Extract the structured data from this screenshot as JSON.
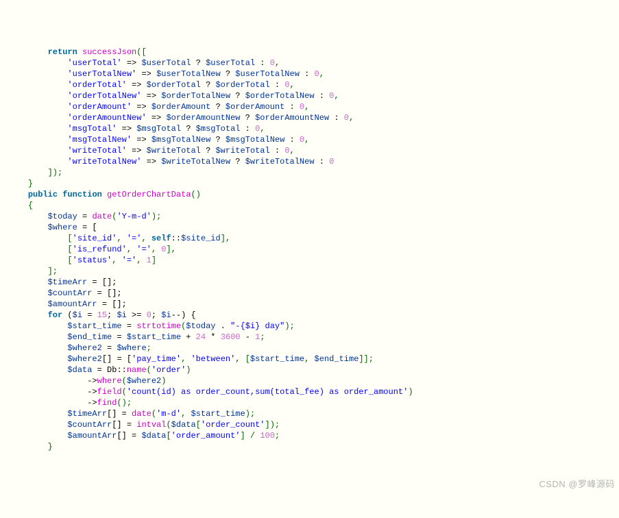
{
  "watermark": "CSDN @罗峰源码",
  "code": {
    "lines": [
      {
        "indent": 2,
        "tokens": [
          {
            "t": "kw",
            "v": "return"
          },
          {
            "t": "plain",
            "v": " "
          },
          {
            "t": "fn",
            "v": "successJson"
          },
          {
            "t": "punc",
            "v": "(["
          }
        ]
      },
      {
        "indent": 3,
        "tokens": [
          {
            "t": "str",
            "v": "'userTotal'"
          },
          {
            "t": "plain",
            "v": " => "
          },
          {
            "t": "var",
            "v": "$userTotal"
          },
          {
            "t": "plain",
            "v": " ? "
          },
          {
            "t": "var",
            "v": "$userTotal"
          },
          {
            "t": "plain",
            "v": " : "
          },
          {
            "t": "num",
            "v": "0"
          },
          {
            "t": "punc",
            "v": ","
          }
        ]
      },
      {
        "indent": 3,
        "tokens": [
          {
            "t": "str",
            "v": "'userTotalNew'"
          },
          {
            "t": "plain",
            "v": " => "
          },
          {
            "t": "var",
            "v": "$userTotalNew"
          },
          {
            "t": "plain",
            "v": " ? "
          },
          {
            "t": "var",
            "v": "$userTotalNew"
          },
          {
            "t": "plain",
            "v": " : "
          },
          {
            "t": "num",
            "v": "0"
          },
          {
            "t": "punc",
            "v": ","
          }
        ]
      },
      {
        "indent": 3,
        "tokens": [
          {
            "t": "str",
            "v": "'orderTotal'"
          },
          {
            "t": "plain",
            "v": " => "
          },
          {
            "t": "var",
            "v": "$orderTotal"
          },
          {
            "t": "plain",
            "v": " ? "
          },
          {
            "t": "var",
            "v": "$orderTotal"
          },
          {
            "t": "plain",
            "v": " : "
          },
          {
            "t": "num",
            "v": "0"
          },
          {
            "t": "punc",
            "v": ","
          }
        ]
      },
      {
        "indent": 3,
        "tokens": [
          {
            "t": "str",
            "v": "'orderTotalNew'"
          },
          {
            "t": "plain",
            "v": " => "
          },
          {
            "t": "var",
            "v": "$orderTotalNew"
          },
          {
            "t": "plain",
            "v": " ? "
          },
          {
            "t": "var",
            "v": "$orderTotalNew"
          },
          {
            "t": "plain",
            "v": " : "
          },
          {
            "t": "num",
            "v": "0"
          },
          {
            "t": "punc",
            "v": ","
          }
        ]
      },
      {
        "indent": 3,
        "tokens": [
          {
            "t": "str",
            "v": "'orderAmount'"
          },
          {
            "t": "plain",
            "v": " => "
          },
          {
            "t": "var",
            "v": "$orderAmount"
          },
          {
            "t": "plain",
            "v": " ? "
          },
          {
            "t": "var",
            "v": "$orderAmount"
          },
          {
            "t": "plain",
            "v": " : "
          },
          {
            "t": "num",
            "v": "0"
          },
          {
            "t": "punc",
            "v": ","
          }
        ]
      },
      {
        "indent": 3,
        "tokens": [
          {
            "t": "str",
            "v": "'orderAmountNew'"
          },
          {
            "t": "plain",
            "v": " => "
          },
          {
            "t": "var",
            "v": "$orderAmountNew"
          },
          {
            "t": "plain",
            "v": " ? "
          },
          {
            "t": "var",
            "v": "$orderAmountNew"
          },
          {
            "t": "plain",
            "v": " : "
          },
          {
            "t": "num",
            "v": "0"
          },
          {
            "t": "punc",
            "v": ","
          }
        ]
      },
      {
        "indent": 3,
        "tokens": [
          {
            "t": "str",
            "v": "'msgTotal'"
          },
          {
            "t": "plain",
            "v": " => "
          },
          {
            "t": "var",
            "v": "$msgTotal"
          },
          {
            "t": "plain",
            "v": " ? "
          },
          {
            "t": "var",
            "v": "$msgTotal"
          },
          {
            "t": "plain",
            "v": " : "
          },
          {
            "t": "num",
            "v": "0"
          },
          {
            "t": "punc",
            "v": ","
          }
        ]
      },
      {
        "indent": 3,
        "tokens": [
          {
            "t": "str",
            "v": "'msgTotalNew'"
          },
          {
            "t": "plain",
            "v": " => "
          },
          {
            "t": "var",
            "v": "$msgTotalNew"
          },
          {
            "t": "plain",
            "v": " ? "
          },
          {
            "t": "var",
            "v": "$msgTotalNew"
          },
          {
            "t": "plain",
            "v": " : "
          },
          {
            "t": "num",
            "v": "0"
          },
          {
            "t": "punc",
            "v": ","
          }
        ]
      },
      {
        "indent": 3,
        "tokens": [
          {
            "t": "str",
            "v": "'writeTotal'"
          },
          {
            "t": "plain",
            "v": " => "
          },
          {
            "t": "var",
            "v": "$writeTotal"
          },
          {
            "t": "plain",
            "v": " ? "
          },
          {
            "t": "var",
            "v": "$writeTotal"
          },
          {
            "t": "plain",
            "v": " : "
          },
          {
            "t": "num",
            "v": "0"
          },
          {
            "t": "punc",
            "v": ","
          }
        ]
      },
      {
        "indent": 3,
        "tokens": [
          {
            "t": "str",
            "v": "'writeTotalNew'"
          },
          {
            "t": "plain",
            "v": " => "
          },
          {
            "t": "var",
            "v": "$writeTotalNew"
          },
          {
            "t": "plain",
            "v": " ? "
          },
          {
            "t": "var",
            "v": "$writeTotalNew"
          },
          {
            "t": "plain",
            "v": " : "
          },
          {
            "t": "num",
            "v": "0"
          }
        ]
      },
      {
        "indent": 2,
        "tokens": [
          {
            "t": "punc",
            "v": "]);"
          }
        ]
      },
      {
        "indent": 1,
        "tokens": [
          {
            "t": "punc",
            "v": "}"
          }
        ]
      },
      {
        "indent": 0,
        "tokens": []
      },
      {
        "indent": 1,
        "tokens": [
          {
            "t": "kw",
            "v": "public"
          },
          {
            "t": "plain",
            "v": " "
          },
          {
            "t": "kw",
            "v": "function"
          },
          {
            "t": "plain",
            "v": " "
          },
          {
            "t": "fn",
            "v": "getOrderChartData"
          },
          {
            "t": "punc",
            "v": "()"
          }
        ]
      },
      {
        "indent": 1,
        "tokens": [
          {
            "t": "punc",
            "v": "{"
          }
        ]
      },
      {
        "indent": 2,
        "tokens": [
          {
            "t": "var",
            "v": "$today"
          },
          {
            "t": "plain",
            "v": " = "
          },
          {
            "t": "fn",
            "v": "date"
          },
          {
            "t": "punc",
            "v": "("
          },
          {
            "t": "str",
            "v": "'Y-m-d'"
          },
          {
            "t": "punc",
            "v": ");"
          }
        ]
      },
      {
        "indent": 2,
        "tokens": [
          {
            "t": "var",
            "v": "$where"
          },
          {
            "t": "plain",
            "v": " = ["
          }
        ]
      },
      {
        "indent": 3,
        "tokens": [
          {
            "t": "punc",
            "v": "["
          },
          {
            "t": "str",
            "v": "'site_id'"
          },
          {
            "t": "punc",
            "v": ", "
          },
          {
            "t": "str",
            "v": "'='"
          },
          {
            "t": "punc",
            "v": ", "
          },
          {
            "t": "kw",
            "v": "self"
          },
          {
            "t": "plain",
            "v": "::"
          },
          {
            "t": "var",
            "v": "$site_id"
          },
          {
            "t": "punc",
            "v": "],"
          }
        ]
      },
      {
        "indent": 3,
        "tokens": [
          {
            "t": "punc",
            "v": "["
          },
          {
            "t": "str",
            "v": "'is_refund'"
          },
          {
            "t": "punc",
            "v": ", "
          },
          {
            "t": "str",
            "v": "'='"
          },
          {
            "t": "punc",
            "v": ", "
          },
          {
            "t": "num",
            "v": "0"
          },
          {
            "t": "punc",
            "v": "],"
          }
        ]
      },
      {
        "indent": 3,
        "tokens": [
          {
            "t": "punc",
            "v": "["
          },
          {
            "t": "str",
            "v": "'status'"
          },
          {
            "t": "punc",
            "v": ", "
          },
          {
            "t": "str",
            "v": "'='"
          },
          {
            "t": "punc",
            "v": ", "
          },
          {
            "t": "num",
            "v": "1"
          },
          {
            "t": "punc",
            "v": "]"
          }
        ]
      },
      {
        "indent": 2,
        "tokens": [
          {
            "t": "punc",
            "v": "];"
          }
        ]
      },
      {
        "indent": 0,
        "tokens": []
      },
      {
        "indent": 2,
        "tokens": [
          {
            "t": "var",
            "v": "$timeArr"
          },
          {
            "t": "plain",
            "v": " = [];"
          }
        ]
      },
      {
        "indent": 2,
        "tokens": [
          {
            "t": "var",
            "v": "$countArr"
          },
          {
            "t": "plain",
            "v": " = [];"
          }
        ]
      },
      {
        "indent": 2,
        "tokens": [
          {
            "t": "var",
            "v": "$amountArr"
          },
          {
            "t": "plain",
            "v": " = [];"
          }
        ]
      },
      {
        "indent": 2,
        "tokens": [
          {
            "t": "kw",
            "v": "for"
          },
          {
            "t": "plain",
            "v": " ("
          },
          {
            "t": "var",
            "v": "$i"
          },
          {
            "t": "plain",
            "v": " = "
          },
          {
            "t": "num",
            "v": "15"
          },
          {
            "t": "plain",
            "v": "; "
          },
          {
            "t": "var",
            "v": "$i"
          },
          {
            "t": "plain",
            "v": " >= "
          },
          {
            "t": "num",
            "v": "0"
          },
          {
            "t": "plain",
            "v": "; "
          },
          {
            "t": "var",
            "v": "$i"
          },
          {
            "t": "plain",
            "v": "--) {"
          }
        ]
      },
      {
        "indent": 3,
        "tokens": [
          {
            "t": "var",
            "v": "$start_time"
          },
          {
            "t": "plain",
            "v": " = "
          },
          {
            "t": "fn",
            "v": "strtotime"
          },
          {
            "t": "punc",
            "v": "("
          },
          {
            "t": "var",
            "v": "$today"
          },
          {
            "t": "plain",
            "v": " . "
          },
          {
            "t": "str",
            "v": "\"-{$i} day\""
          },
          {
            "t": "punc",
            "v": ");"
          }
        ]
      },
      {
        "indent": 3,
        "tokens": [
          {
            "t": "var",
            "v": "$end_time"
          },
          {
            "t": "plain",
            "v": " = "
          },
          {
            "t": "var",
            "v": "$start_time"
          },
          {
            "t": "plain",
            "v": " + "
          },
          {
            "t": "num",
            "v": "24"
          },
          {
            "t": "plain",
            "v": " * "
          },
          {
            "t": "num",
            "v": "3600"
          },
          {
            "t": "plain",
            "v": " - "
          },
          {
            "t": "num",
            "v": "1"
          },
          {
            "t": "punc",
            "v": ";"
          }
        ]
      },
      {
        "indent": 0,
        "tokens": []
      },
      {
        "indent": 3,
        "tokens": [
          {
            "t": "var",
            "v": "$where2"
          },
          {
            "t": "plain",
            "v": " = "
          },
          {
            "t": "var",
            "v": "$where"
          },
          {
            "t": "punc",
            "v": ";"
          }
        ]
      },
      {
        "indent": 3,
        "tokens": [
          {
            "t": "var",
            "v": "$where2"
          },
          {
            "t": "plain",
            "v": "[] = ["
          },
          {
            "t": "str",
            "v": "'pay_time'"
          },
          {
            "t": "punc",
            "v": ", "
          },
          {
            "t": "str",
            "v": "'between'"
          },
          {
            "t": "punc",
            "v": ", ["
          },
          {
            "t": "var",
            "v": "$start_time"
          },
          {
            "t": "punc",
            "v": ", "
          },
          {
            "t": "var",
            "v": "$end_time"
          },
          {
            "t": "punc",
            "v": "]];"
          }
        ]
      },
      {
        "indent": 3,
        "tokens": [
          {
            "t": "var",
            "v": "$data"
          },
          {
            "t": "plain",
            "v": " = Db::"
          },
          {
            "t": "fn",
            "v": "name"
          },
          {
            "t": "punc",
            "v": "("
          },
          {
            "t": "str",
            "v": "'order'"
          },
          {
            "t": "punc",
            "v": ")"
          }
        ]
      },
      {
        "indent": 4,
        "tokens": [
          {
            "t": "plain",
            "v": "->"
          },
          {
            "t": "fn",
            "v": "where"
          },
          {
            "t": "punc",
            "v": "("
          },
          {
            "t": "var",
            "v": "$where2"
          },
          {
            "t": "punc",
            "v": ")"
          }
        ]
      },
      {
        "indent": 4,
        "tokens": [
          {
            "t": "plain",
            "v": "->"
          },
          {
            "t": "fn",
            "v": "field"
          },
          {
            "t": "punc",
            "v": "("
          },
          {
            "t": "str",
            "v": "'count(id) as order_count,sum(total_fee) as order_amount'"
          },
          {
            "t": "punc",
            "v": ")"
          }
        ]
      },
      {
        "indent": 4,
        "tokens": [
          {
            "t": "plain",
            "v": "->"
          },
          {
            "t": "fn",
            "v": "find"
          },
          {
            "t": "punc",
            "v": "();"
          }
        ]
      },
      {
        "indent": 0,
        "tokens": []
      },
      {
        "indent": 3,
        "tokens": [
          {
            "t": "var",
            "v": "$timeArr"
          },
          {
            "t": "plain",
            "v": "[] = "
          },
          {
            "t": "fn",
            "v": "date"
          },
          {
            "t": "punc",
            "v": "("
          },
          {
            "t": "str",
            "v": "'m-d'"
          },
          {
            "t": "punc",
            "v": ", "
          },
          {
            "t": "var",
            "v": "$start_time"
          },
          {
            "t": "punc",
            "v": ");"
          }
        ]
      },
      {
        "indent": 3,
        "tokens": [
          {
            "t": "var",
            "v": "$countArr"
          },
          {
            "t": "plain",
            "v": "[] = "
          },
          {
            "t": "fn",
            "v": "intval"
          },
          {
            "t": "punc",
            "v": "("
          },
          {
            "t": "var",
            "v": "$data"
          },
          {
            "t": "punc",
            "v": "["
          },
          {
            "t": "str",
            "v": "'order_count'"
          },
          {
            "t": "punc",
            "v": "]);"
          }
        ]
      },
      {
        "indent": 3,
        "tokens": [
          {
            "t": "var",
            "v": "$amountArr"
          },
          {
            "t": "plain",
            "v": "[] = "
          },
          {
            "t": "var",
            "v": "$data"
          },
          {
            "t": "punc",
            "v": "["
          },
          {
            "t": "str",
            "v": "'order_amount'"
          },
          {
            "t": "punc",
            "v": "] / "
          },
          {
            "t": "num",
            "v": "100"
          },
          {
            "t": "punc",
            "v": ";"
          }
        ]
      },
      {
        "indent": 2,
        "tokens": [
          {
            "t": "punc",
            "v": "}"
          }
        ]
      }
    ]
  }
}
